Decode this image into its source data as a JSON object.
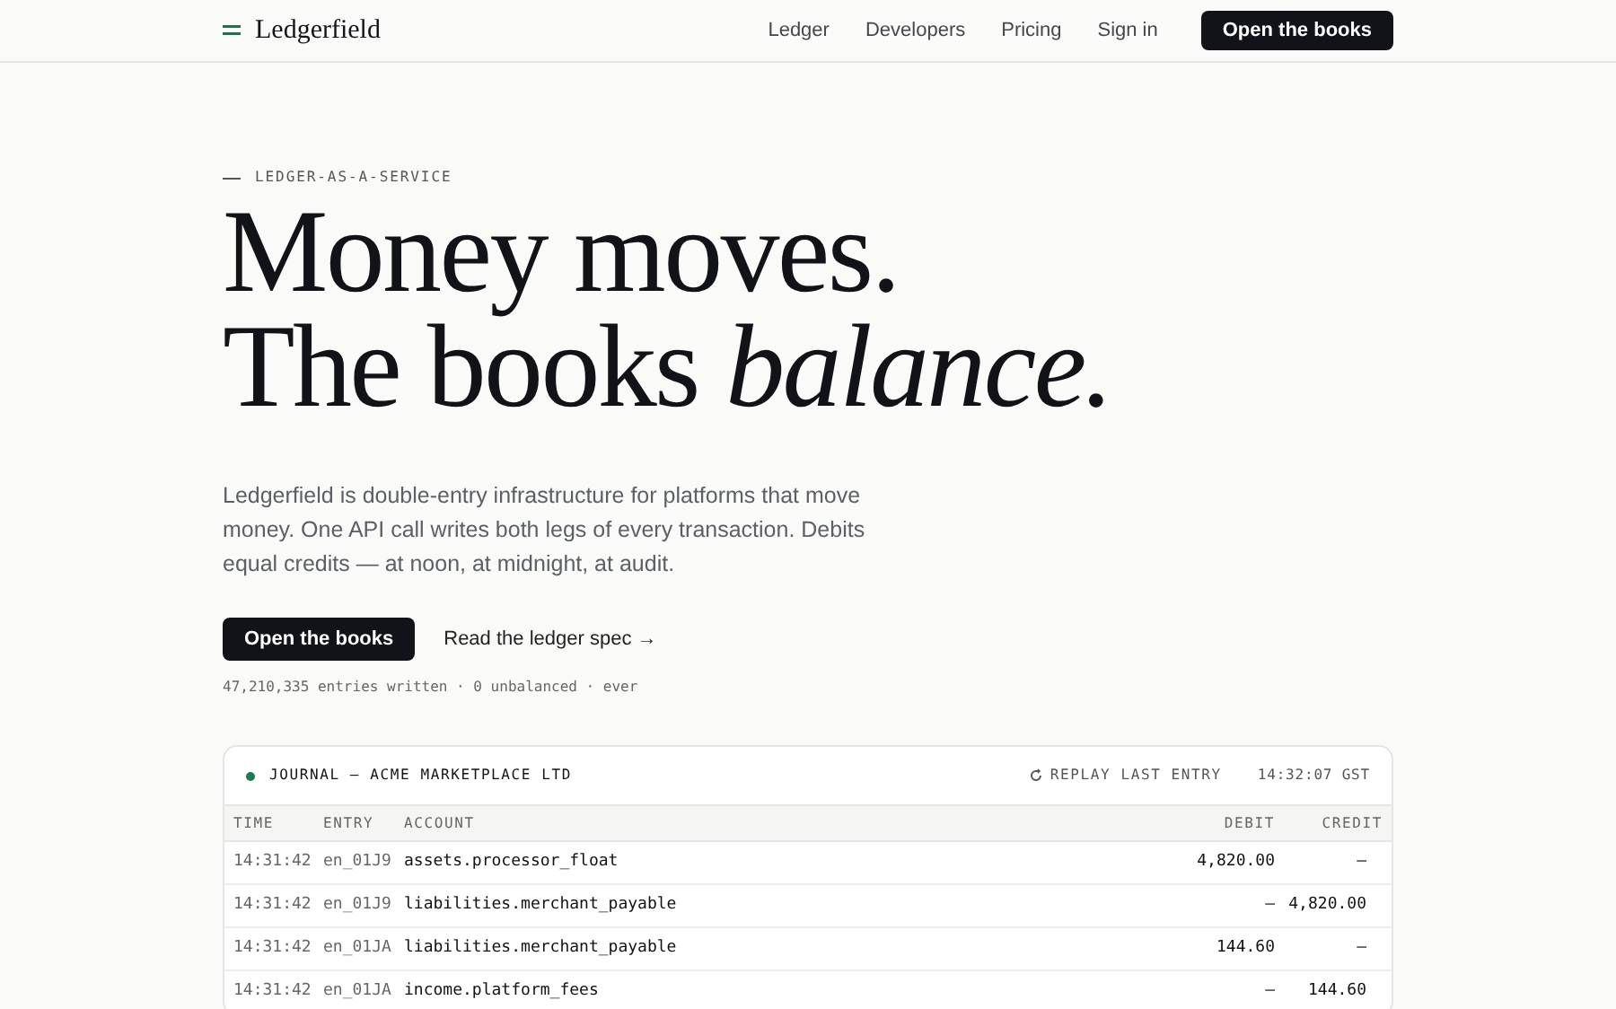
{
  "nav": {
    "brand": "Ledgerfield",
    "links": [
      "Ledger",
      "Developers",
      "Pricing",
      "Sign in"
    ],
    "cta": "Open the books"
  },
  "hero": {
    "eyebrow": "LEDGER-AS-A-SERVICE",
    "headline": [
      "Money moves.",
      "The books *balance.*"
    ],
    "body": "Ledgerfield is double-entry infrastructure for platforms that move money. One API call writes both legs of every transaction. Debits equal credits — at noon, at midnight, at audit.",
    "primary_button": "Open the books",
    "secondary_link": "Read the ledger spec →",
    "stats": "47,210,335 entries written · 0 unbalanced · ever"
  },
  "journal": {
    "title": "JOURNAL — ACME MARKETPLACE LTD",
    "replay": "REPLAY LAST ENTRY",
    "clock": "14:32:07 GST",
    "columns": [
      "TIME",
      "ENTRY",
      "ACCOUNT",
      "DEBIT",
      "CREDIT"
    ],
    "rows": [
      {
        "time": "14:31:42",
        "entry": "en_01J9",
        "account": "assets.processor_float",
        "debit": "4,820.00",
        "credit": "—"
      },
      {
        "time": "14:31:42",
        "entry": "en_01J9",
        "account": "liabilities.merchant_payable",
        "debit": "—",
        "credit": "4,820.00"
      },
      {
        "time": "14:31:42",
        "entry": "en_01JA",
        "account": "liabilities.merchant_payable",
        "debit": "144.60",
        "credit": "—"
      },
      {
        "time": "14:31:42",
        "entry": "en_01JA",
        "account": "income.platform_fees",
        "debit": "—",
        "credit": "144.60"
      }
    ]
  }
}
